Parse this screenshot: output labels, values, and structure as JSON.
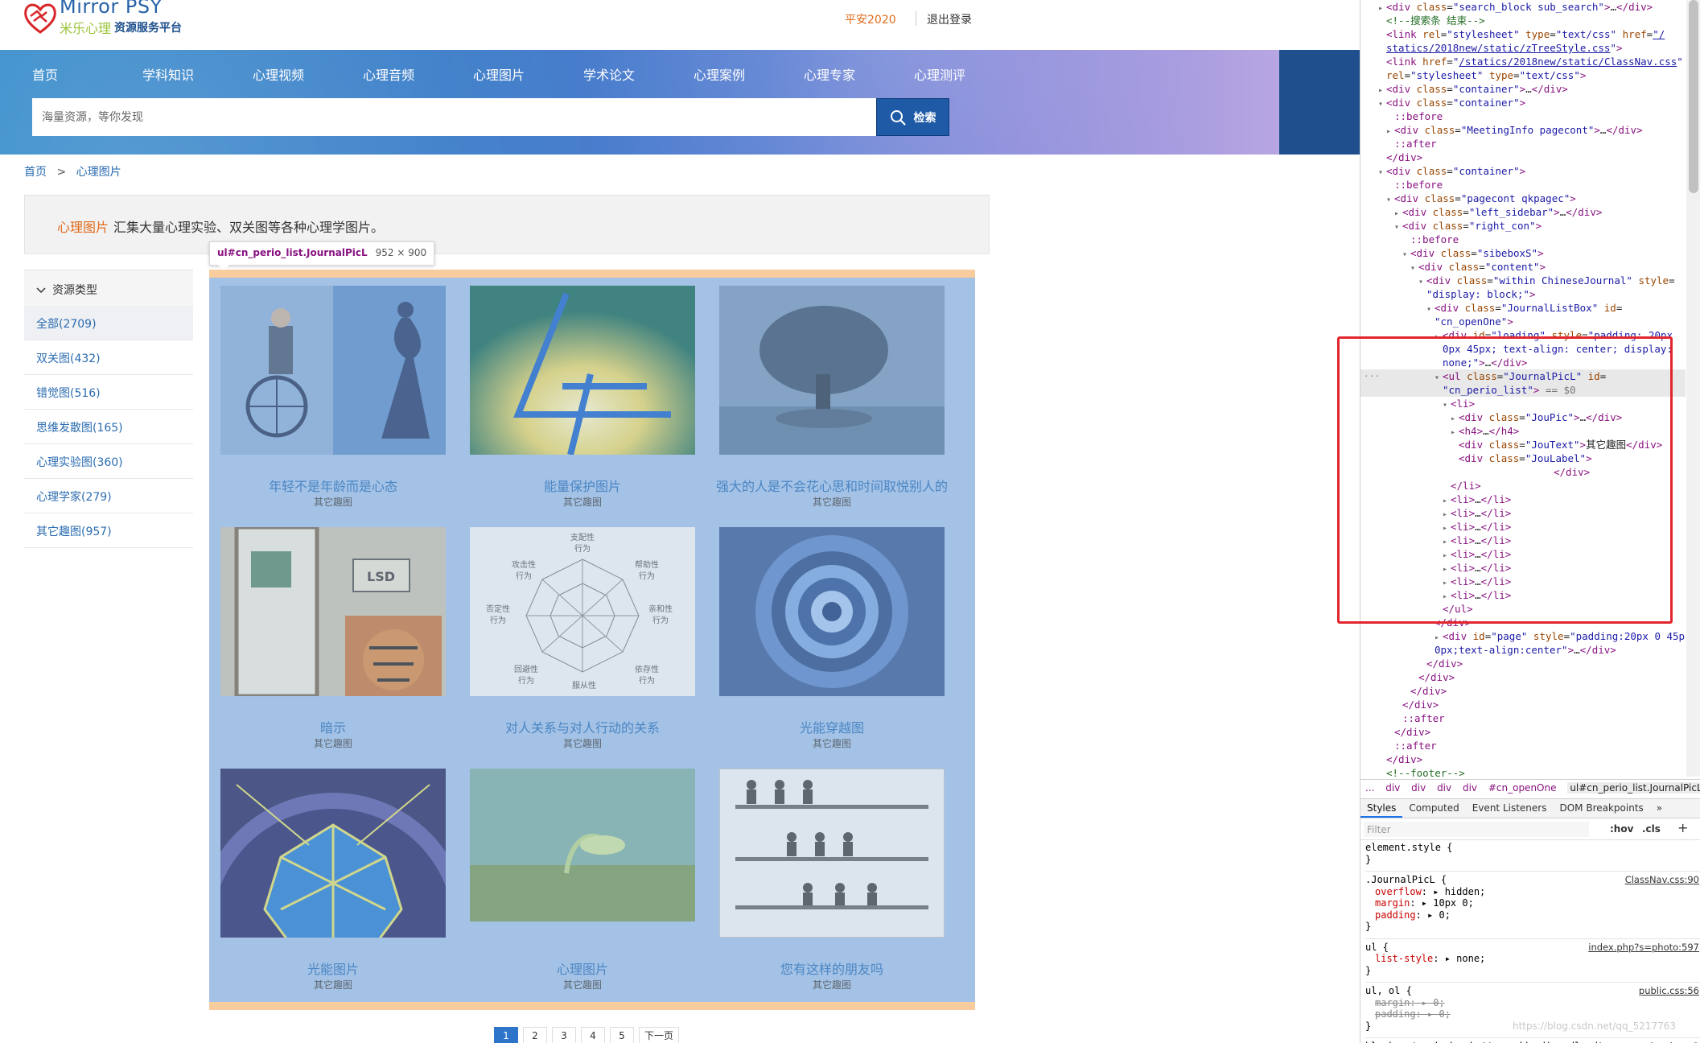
{
  "site": {
    "logo": {
      "en": "Mirror PSY",
      "cn_brand": "米乐心理",
      "cn_tagline": "资源服务平台"
    },
    "user": {
      "name": "平安2020",
      "logout": "退出登录"
    },
    "nav": [
      "首页",
      "学科知识",
      "心理视频",
      "心理音频",
      "心理图片",
      "学术论文",
      "心理案例",
      "心理专家",
      "心理测评"
    ],
    "search": {
      "placeholder": "海量资源，等你发现",
      "button": "检索"
    },
    "breadcrumb": {
      "home": "首页",
      "sep": ">",
      "current": "心理图片"
    },
    "intro": {
      "highlight": "心理图片",
      "text": "汇集大量心理实验、双关图等各种心理学图片。"
    },
    "sidebar": {
      "header": "资源类型",
      "items": [
        "全部(2709)",
        "双关图(432)",
        "错觉图(516)",
        "思维发散图(165)",
        "心理实验图(360)",
        "心理学家(279)",
        "其它趣图(957)"
      ]
    },
    "tooltip": {
      "selector": "ul#cn_perio_list.JournalPicL",
      "size": "952 × 900"
    },
    "cards": [
      {
        "title": "年轻不是年龄而是心态",
        "sub": "其它趣图"
      },
      {
        "title": "能量保护图片",
        "sub": "其它趣图"
      },
      {
        "title": "强大的人是不会花心思和时间取悦别人的",
        "sub": "其它趣图"
      },
      {
        "title": "暗示",
        "sub": "其它趣图"
      },
      {
        "title": "对人关系与对人行动的关系",
        "sub": "其它趣图"
      },
      {
        "title": "光能穿越图",
        "sub": "其它趣图"
      },
      {
        "title": "光能图片",
        "sub": "其它趣图"
      },
      {
        "title": "心理图片",
        "sub": "其它趣图"
      },
      {
        "title": "您有这样的朋友吗",
        "sub": "其它趣图"
      }
    ],
    "diagram_labels": {
      "top": "支配性",
      "top2": "行为",
      "ul": "攻击性",
      "ul2": "行为",
      "ur": "帮助性",
      "ur2": "行为",
      "l": "否定性",
      "l2": "行为",
      "r": "亲和性",
      "r2": "行为",
      "ll": "回避性",
      "ll2": "行为",
      "lr": "依存性",
      "lr2": "行为",
      "bottom": "服从性"
    },
    "sign_text": "LSD",
    "pagination": [
      "1",
      "2",
      "3",
      "4",
      "5",
      "下一页"
    ]
  },
  "devtools": {
    "crumbs": [
      "...",
      "div",
      "div",
      "div",
      "div",
      "#cn_openOne",
      "ul#cn_perio_list.JournalPicL"
    ],
    "tabs": [
      "Styles",
      "Computed",
      "Event Listeners",
      "DOM Breakpoints",
      "»"
    ],
    "filter_placeholder": "Filter",
    "hov": ":hov",
    "cls": ".cls",
    "plus": "+",
    "dots": "...",
    "eq_marker": "== $0",
    "watermark": "https://blog.csdn.net/qq_5217763"
  },
  "colors": {
    "accent": "#2e75c9",
    "highlight_orange": "#e06a1b",
    "overlay_blue": "#a4c2e5",
    "overlay_orange": "#f9cc9e",
    "red_box": "#e2262d"
  }
}
